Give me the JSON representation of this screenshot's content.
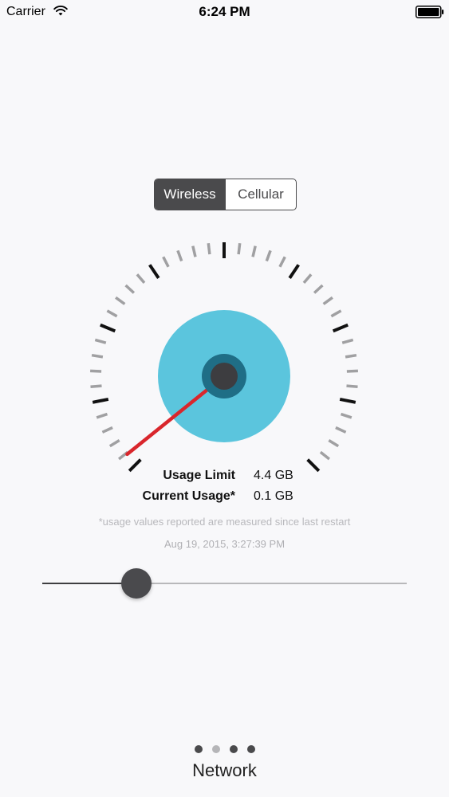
{
  "status_bar": {
    "carrier": "Carrier",
    "time": "6:24 PM"
  },
  "segmented_control": {
    "options": [
      "Wireless",
      "Cellular"
    ],
    "selected": 0
  },
  "gauge": {
    "value_fraction": 0.0227,
    "colors": {
      "dial": "#5bc5dd",
      "hub_ring": "#1f6e86",
      "hub": "#3d3d40",
      "needle": "#d9262c",
      "major_tick": "#111111",
      "minor_tick": "#a0a0a2"
    }
  },
  "usage": {
    "limit_label": "Usage Limit",
    "limit_value": "4.4 GB",
    "current_label": "Current Usage*",
    "current_value": "0.1 GB",
    "note": "*usage values reported are measured since last restart",
    "timestamp": "Aug 19, 2015, 3:27:39 PM"
  },
  "slider": {
    "value_fraction": 0.236
  },
  "pager": {
    "page_count": 4,
    "current_page": 1,
    "title": "Network"
  }
}
